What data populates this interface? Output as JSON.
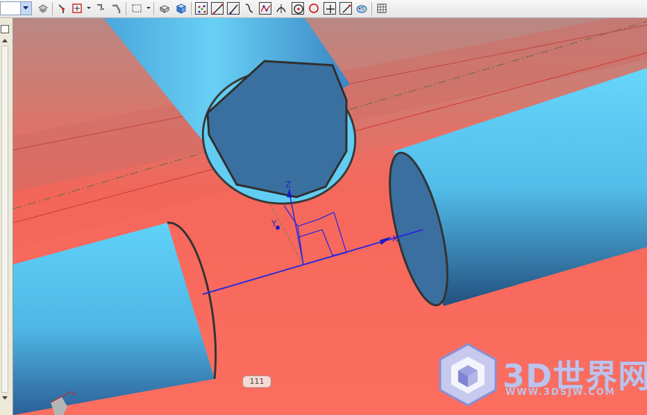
{
  "toolbar": {
    "combo_value": "",
    "buttons": [
      "layer-icon",
      "snap-point-icon",
      "select-filter-icon",
      "route-icon",
      "handle-icon",
      "selection-box-icon",
      "shaded-box-icon",
      "solid-cube-icon",
      "point-cloud-icon",
      "line-icon",
      "slant-line-icon",
      "curve-icon",
      "spline-icon",
      "tangent-icon",
      "circle-point-icon",
      "circle-icon",
      "cross-icon",
      "pen-icon",
      "palette-icon",
      "grid-icon"
    ]
  },
  "viewport": {
    "tag_label": "111",
    "axes": {
      "x": "X",
      "y": "Y",
      "z": "Z",
      "triad_x": "x"
    },
    "colors": {
      "background_red": "#f26a5e",
      "pipe_blue": "#58c6ee",
      "pipe_face": "#3b6f9e",
      "axis_blue": "#2b2bdb"
    }
  },
  "watermark": {
    "title": "3D世界网",
    "subtitle": "WWW.3DSJW.COM"
  }
}
